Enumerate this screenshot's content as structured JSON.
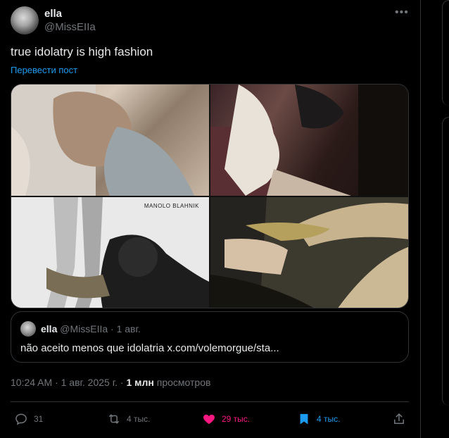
{
  "author": {
    "name": "ella",
    "handle": "@MissEIIa"
  },
  "more_glyph": "•••",
  "tweet": {
    "text": "true idolatry is high fashion",
    "translate_label": "Перевести пост",
    "photo3_caption": "MANOLO BLAHNIK"
  },
  "quote": {
    "name": "ella",
    "handle": "@MissEIIa",
    "dot": "·",
    "date": "1 авг.",
    "text": "não aceito menos que idolatria x.com/volemorgue/sta..."
  },
  "timestamp": {
    "time": "10:24 AM",
    "dot": "·",
    "date": "1 авг. 2025 г.",
    "dot2": "·",
    "views_count": "1 млн",
    "views_label": "просмотров"
  },
  "actions": {
    "replies": "31",
    "reposts": "4 тыс.",
    "likes": "29 тыс.",
    "bookmarks": "4 тыс."
  },
  "colors": {
    "accent": "#1d9bf0",
    "like": "#f91880",
    "muted": "#71767b",
    "text": "#e7e9ea"
  }
}
